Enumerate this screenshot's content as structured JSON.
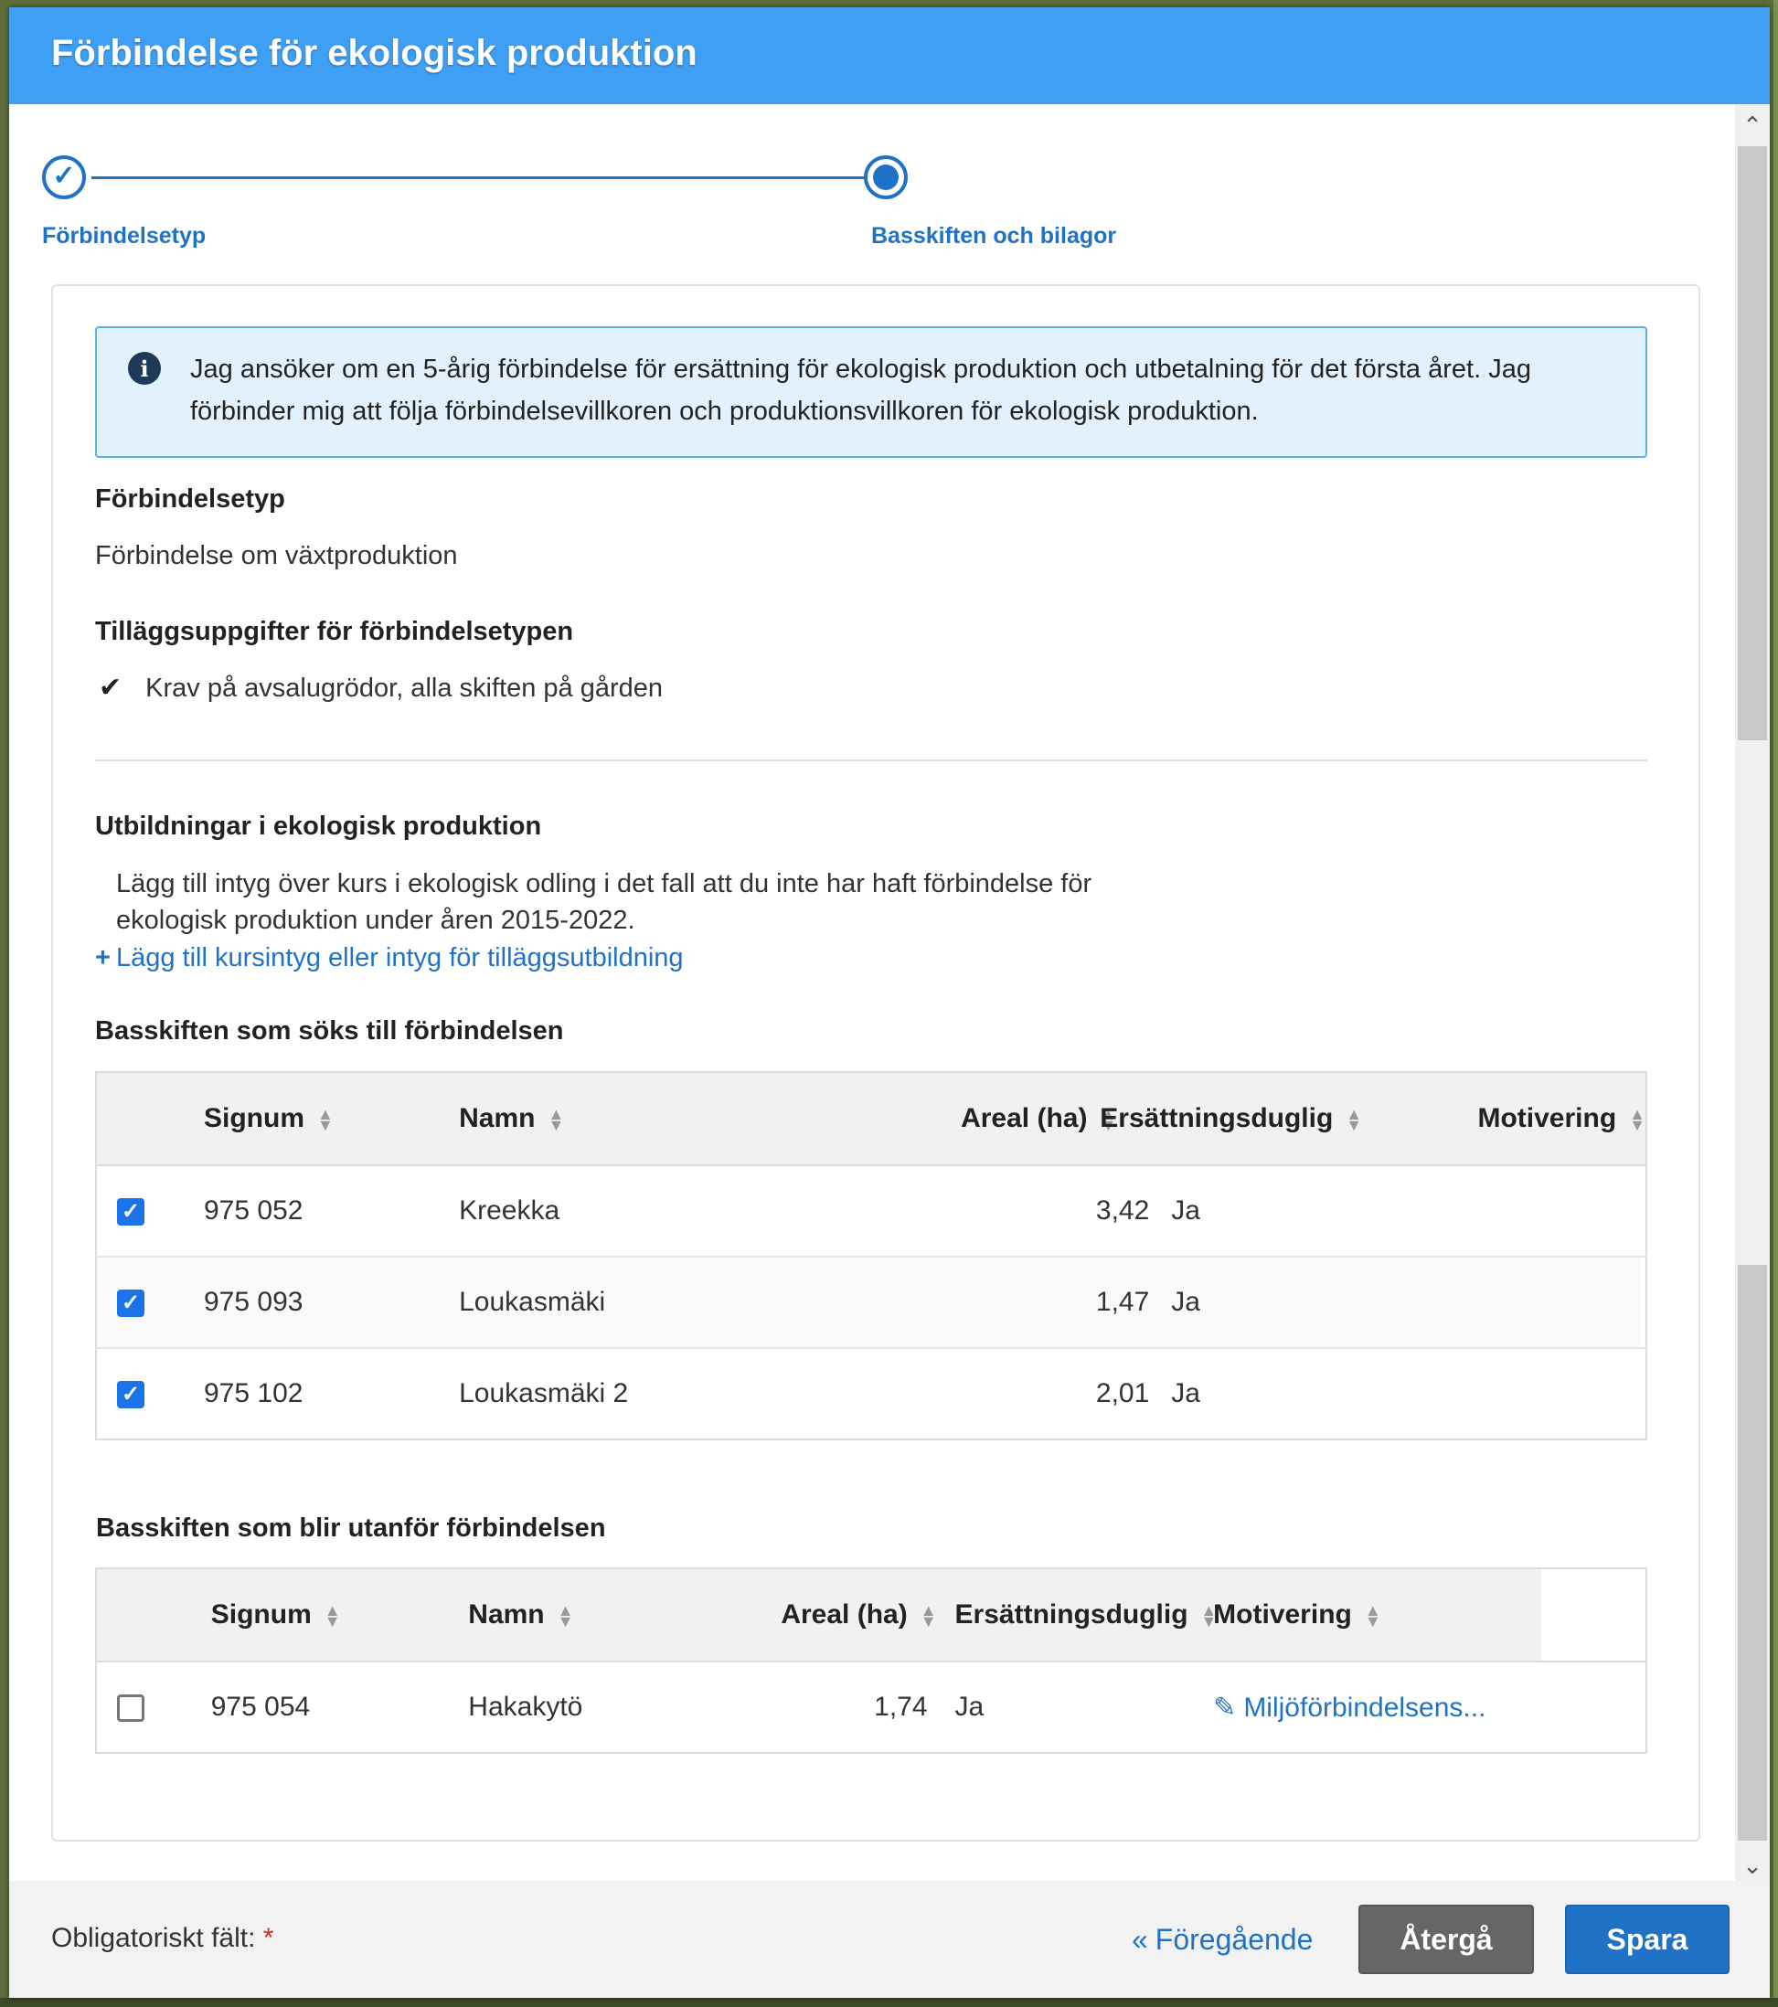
{
  "modal": {
    "title": "Förbindelse för ekologisk produktion"
  },
  "stepper": {
    "steps": [
      {
        "label": "Förbindelsetyp",
        "state": "completed"
      },
      {
        "label": "Basskiften och bilagor",
        "state": "active"
      }
    ]
  },
  "info": {
    "icon": "info-circle-icon",
    "text": "Jag ansöker om en 5-årig förbindelse för ersättning för ekologisk produktion och utbetalning för det första året. Jag förbinder mig att följa förbindelsevillkoren och produktionsvillkoren för ekologisk produktion."
  },
  "commitment_type": {
    "heading": "Förbindelsetyp",
    "value": "Förbindelse om växtproduktion"
  },
  "additional_info": {
    "heading": "Tilläggsuppgifter för förbindelsetypen",
    "items": [
      "Krav på avsalugrödor, alla skiften på gården"
    ]
  },
  "training": {
    "heading": "Utbildningar i ekologisk produktion",
    "description_line1": "Lägg till intyg över kurs i ekologisk odling i det fall att du inte har haft förbindelse för",
    "description_line2": "ekologisk produktion under åren 2015-2022.",
    "add_link": "Lägg till kursintyg eller intyg för tilläggsutbildning"
  },
  "included_parcels": {
    "heading": "Basskiften som söks till förbindelsen",
    "columns": [
      "Signum",
      "Namn",
      "Areal (ha)",
      "Ersättningsduglig",
      "Motivering"
    ],
    "rows": [
      {
        "checked": true,
        "signum": "975 052",
        "name": "Kreekka",
        "area": "3,42",
        "eligible": "Ja",
        "motivation": ""
      },
      {
        "checked": true,
        "signum": "975 093",
        "name": "Loukasmäki",
        "area": "1,47",
        "eligible": "Ja",
        "motivation": ""
      },
      {
        "checked": true,
        "signum": "975 102",
        "name": "Loukasmäki 2",
        "area": "2,01",
        "eligible": "Ja",
        "motivation": ""
      }
    ]
  },
  "excluded_parcels": {
    "heading": "Basskiften som blir utanför förbindelsen",
    "columns": [
      "Signum",
      "Namn",
      "Areal (ha)",
      "Ersättningsduglig",
      "Motivering"
    ],
    "rows": [
      {
        "checked": false,
        "signum": "975 054",
        "name": "Hakakytö",
        "area": "1,74",
        "eligible": "Ja",
        "motivation": "Miljöförbindelsens..."
      }
    ]
  },
  "footer": {
    "required_label": "Obligatoriskt fält:",
    "required_marker": "*",
    "previous_link": "Föregående",
    "cancel_button": "Återgå",
    "save_button": "Spara"
  },
  "colors": {
    "header": "#3e9ff5",
    "primary": "#1f72c6",
    "checkbox": "#1a73e8",
    "cancel": "#666666",
    "required": "#d9262a"
  }
}
